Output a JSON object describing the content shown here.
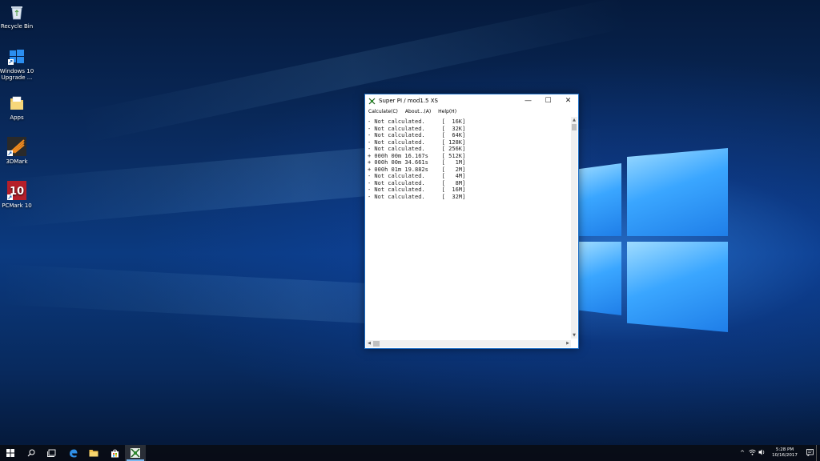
{
  "desktop": {
    "icons": [
      {
        "label": "Recycle Bin",
        "icon": "recycle-bin-icon"
      },
      {
        "label": "Windows 10 Upgrade ...",
        "icon": "windows-upgrade-icon"
      },
      {
        "label": "Apps",
        "icon": "folder-icon"
      },
      {
        "label": "3DMark",
        "icon": "3dmark-icon"
      },
      {
        "label": "PCMark 10",
        "icon": "pcmark-icon"
      }
    ]
  },
  "window": {
    "title": "Super PI / mod1.5 XS",
    "controls": {
      "minimize": "—",
      "maximize": "☐",
      "close": "✕"
    },
    "menu": [
      "Calculate(C)",
      "About...(A)",
      "Help(H)"
    ],
    "results": [
      "- Not calculated.     [  16K]",
      "- Not calculated.     [  32K]",
      "- Not calculated.     [  64K]",
      "- Not calculated.     [ 128K]",
      "- Not calculated.     [ 256K]",
      "+ 000h 00m 16.167s    [ 512K]",
      "+ 000h 00m 34.661s    [   1M]",
      "+ 000h 01m 19.882s    [   2M]",
      "- Not calculated.     [   4M]",
      "- Not calculated.     [   8M]",
      "- Not calculated.     [  16M]",
      "- Not calculated.     [  32M]"
    ]
  },
  "taskbar": {
    "buttons": [
      {
        "name": "start-button",
        "icon": "windows-logo-icon"
      },
      {
        "name": "search-button",
        "icon": "search-icon"
      },
      {
        "name": "task-view-button",
        "icon": "task-view-icon"
      },
      {
        "name": "edge-button",
        "icon": "edge-icon"
      },
      {
        "name": "file-explorer-button",
        "icon": "folder-icon"
      },
      {
        "name": "store-button",
        "icon": "store-icon"
      },
      {
        "name": "superpi-taskbar-button",
        "icon": "superpi-icon"
      }
    ],
    "tray": {
      "time": "5:28 PM",
      "date": "10/16/2017",
      "icons": [
        "chevron-up-icon",
        "network-icon",
        "volume-icon"
      ]
    }
  },
  "colors": {
    "taskbar": "#080c16",
    "window_border": "#1e6ec4",
    "accent": "#3aa6ff"
  }
}
